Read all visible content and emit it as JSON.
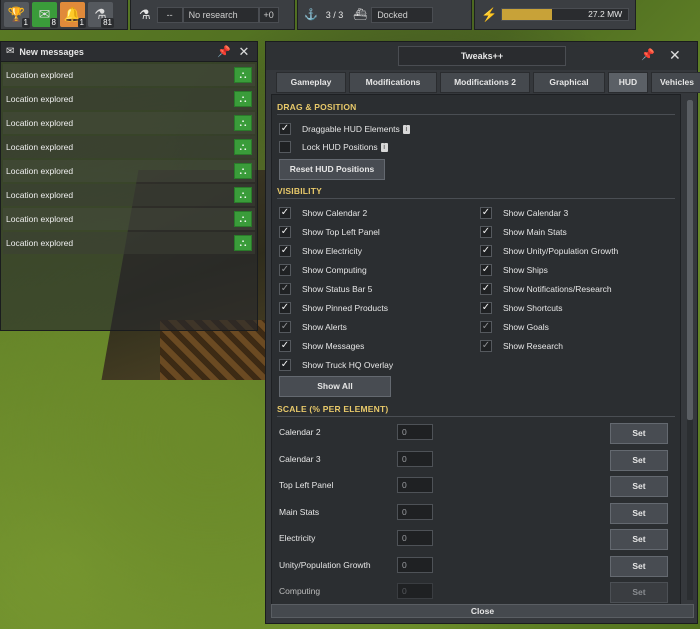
{
  "topbar": {
    "achievements_count": "1",
    "messages_count": "8",
    "notifications_count": "1",
    "research_count": "81",
    "research_progress": "--",
    "research_label": "No research",
    "research_rate": "+0",
    "crew": "3 / 3",
    "ship_status": "Docked",
    "power": "27.2 MW"
  },
  "messages": {
    "title": "New messages",
    "items": [
      "Location explored",
      "Location explored",
      "Location explored",
      "Location explored",
      "Location explored",
      "Location explored",
      "Location explored",
      "Location explored"
    ]
  },
  "window": {
    "title": "Tweaks++",
    "tabs": [
      "Gameplay",
      "Modifications",
      "Modifications 2",
      "Graphical",
      "HUD",
      "Vehicles"
    ],
    "active_tab": "HUD",
    "drag_section": "DRAG & POSITION",
    "draggable_label": "Draggable HUD Elements",
    "lock_label": "Lock HUD Positions",
    "reset_button": "Reset HUD Positions",
    "visibility_section": "VISIBILITY",
    "left_checks": [
      "Show Calendar 2",
      "Show Top Left Panel",
      "Show Electricity",
      "Show Computing",
      "Show Status Bar 5",
      "Show Pinned Products",
      "Show Alerts",
      "Show Messages",
      "Show Truck HQ Overlay"
    ],
    "right_checks": [
      "Show Calendar 3",
      "Show Main Stats",
      "Show Unity/Population Growth",
      "Show Ships",
      "Show Notifications/Research",
      "Show Shortcuts",
      "Show Goals",
      "Show Research"
    ],
    "show_all_button": "Show All",
    "scale_section": "SCALE (% PER ELEMENT)",
    "scale_rows": [
      {
        "label": "Calendar 2",
        "value": "0",
        "button": "Set"
      },
      {
        "label": "Calendar 3",
        "value": "0",
        "button": "Set"
      },
      {
        "label": "Top Left Panel",
        "value": "0",
        "button": "Set"
      },
      {
        "label": "Main Stats",
        "value": "0",
        "button": "Set"
      },
      {
        "label": "Electricity",
        "value": "0",
        "button": "Set"
      },
      {
        "label": "Unity/Population Growth",
        "value": "0",
        "button": "Set"
      },
      {
        "label": "Computing",
        "value": "0",
        "button": "Set"
      }
    ],
    "close_button": "Close"
  },
  "colors": {
    "accent_section": "#e8c96a",
    "green_action": "#3a9c3a",
    "power_bar": "#c8a238"
  }
}
